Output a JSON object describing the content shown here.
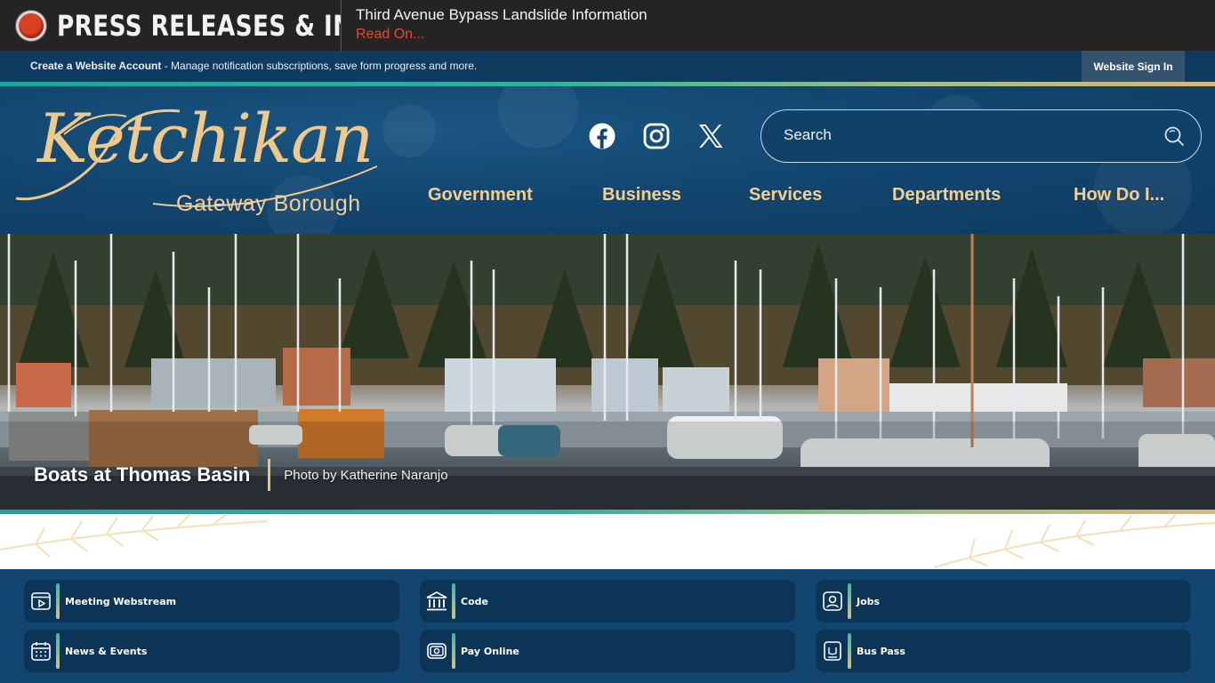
{
  "alert": {
    "label": "PRESS RELEASES & INF",
    "message": "Third Avenue Bypass Landslide Information",
    "link": "Read On..."
  },
  "account": {
    "create_link": "Create a Website Account",
    "description": " - Manage notification subscriptions, save form progress and more.",
    "signin": "Website Sign In"
  },
  "logo": {
    "main": "Ketchikan",
    "sub": "Gateway Borough"
  },
  "social": [
    {
      "icon": "facebook-icon"
    },
    {
      "icon": "instagram-icon"
    },
    {
      "icon": "x-icon"
    }
  ],
  "search": {
    "placeholder": "Search",
    "icon": "search-icon"
  },
  "nav": {
    "government": "Government",
    "business": "Business",
    "services": "Services",
    "departments": "Departments",
    "howdoi": "How Do I..."
  },
  "hero": {
    "title": "Boats at Thomas Basin",
    "credit": "Photo by Katherine Naranjo"
  },
  "quick_links": {
    "webstream": "Meeting Webstream",
    "code": "Code",
    "jobs": "Jobs",
    "news": "News & Events",
    "pay": "Pay Online",
    "bus": "Bus Pass"
  },
  "colors": {
    "navy": "#124670",
    "gold": "#f3cf91",
    "alert_red": "#e44a2e",
    "teal_accent": "#1fa3a0"
  }
}
